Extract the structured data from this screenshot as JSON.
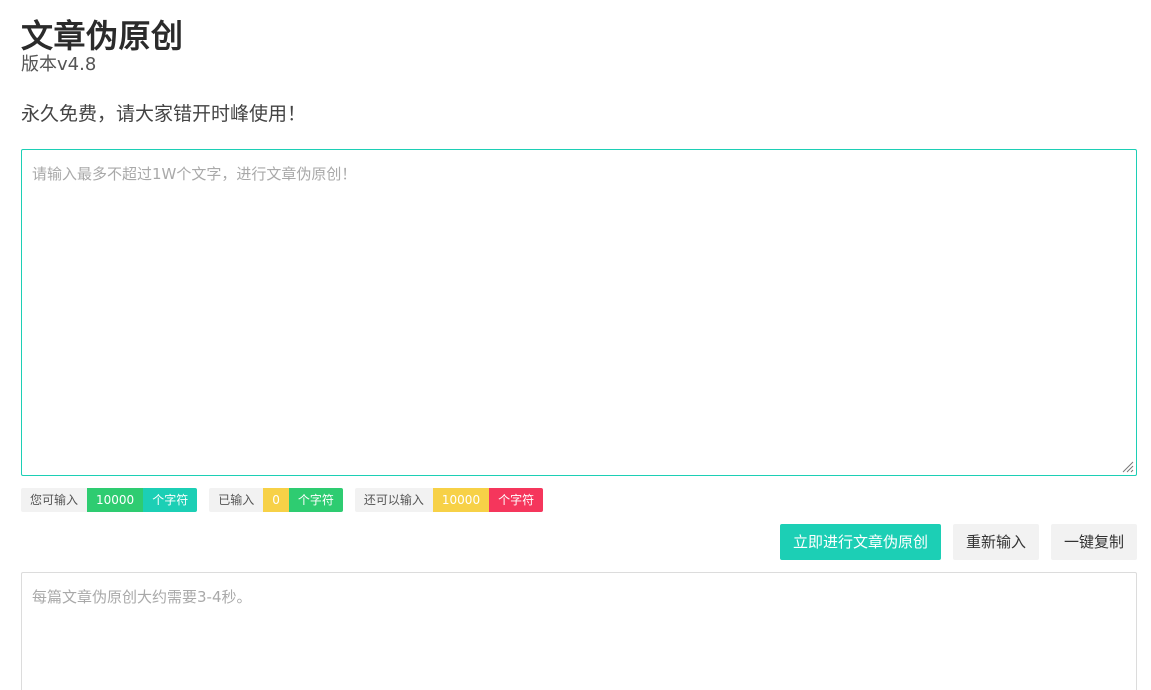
{
  "header": {
    "title": "文章伪原创",
    "version": "版本v4.8",
    "tagline": "永久免费，请大家错开时峰使用！"
  },
  "editor": {
    "value": "",
    "placeholder": "请输入最多不超过1W个文字，进行文章伪原创！"
  },
  "counters": [
    {
      "label": "您可输入",
      "value": "10000",
      "unit": "个字符",
      "value_color": "#2ecc71",
      "unit_color": "#1ccfb5"
    },
    {
      "label": "已输入",
      "value": "0",
      "unit": "个字符",
      "value_color": "#f7d147",
      "unit_color": "#2ecc71"
    },
    {
      "label": "还可以输入",
      "value": "10000",
      "unit": "个字符",
      "value_color": "#f7d147",
      "unit_color": "#f5365c"
    }
  ],
  "actions": {
    "rewrite_label": "立即进行文章伪原创",
    "reset_label": "重新输入",
    "copy_label": "一键复制"
  },
  "output": {
    "value": "",
    "placeholder": "每篇文章伪原创大约需要3-4秒。"
  },
  "colors": {
    "accent": "#1ccfb5",
    "green": "#2ecc71",
    "yellow": "#f7d147",
    "red": "#f5365c"
  }
}
